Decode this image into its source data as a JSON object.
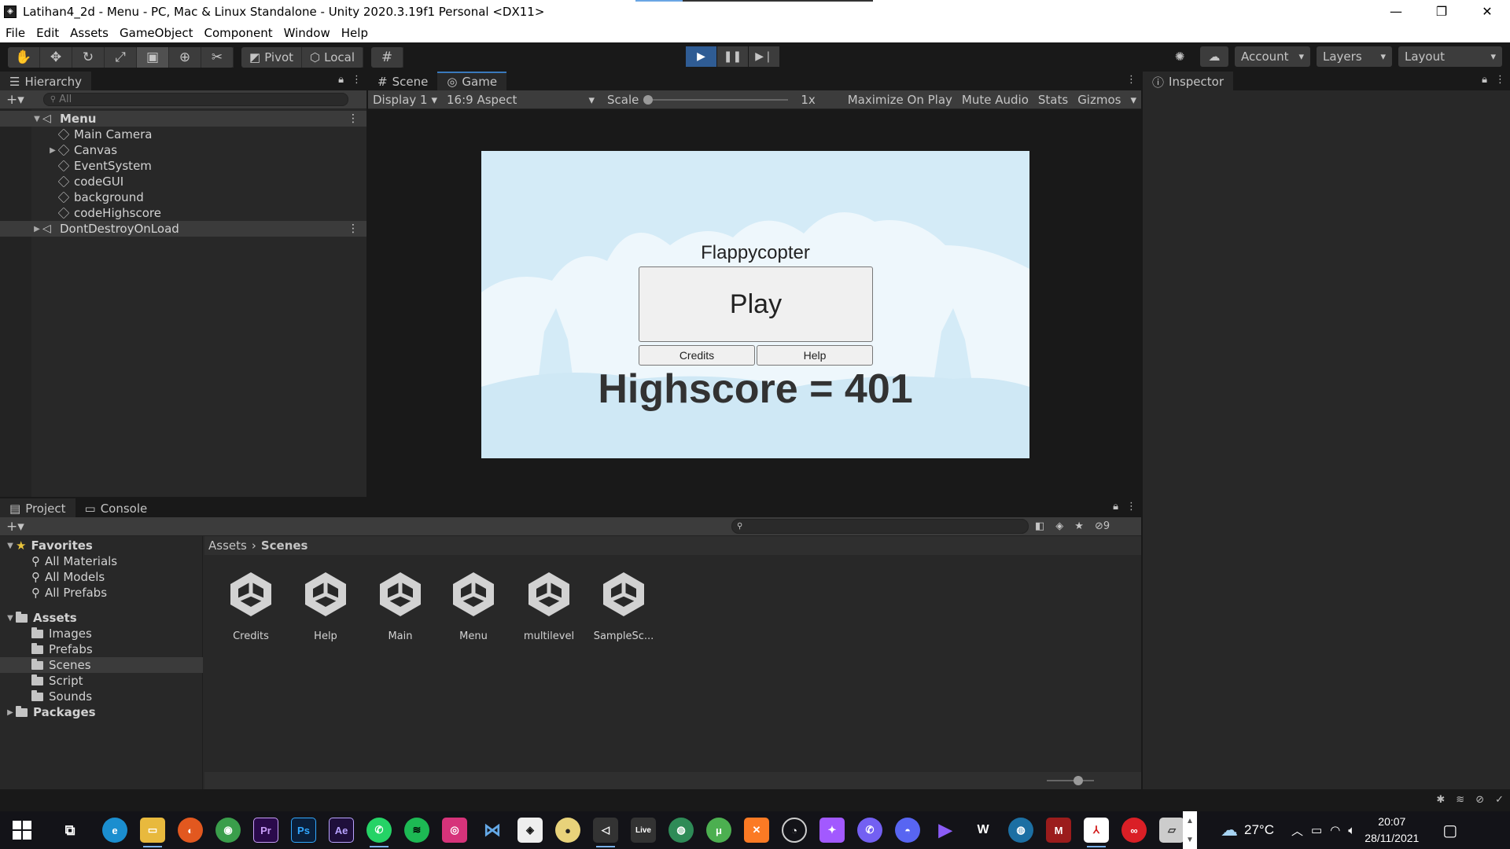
{
  "window": {
    "title": "Latihan4_2d - Menu - PC, Mac & Linux Standalone - Unity 2020.3.19f1 Personal <DX11>",
    "progress_fraction": 0.2
  },
  "menu": [
    "File",
    "Edit",
    "Assets",
    "GameObject",
    "Component",
    "Window",
    "Help"
  ],
  "toolbar": {
    "tools": [
      "hand-tool",
      "move-tool",
      "rotate-tool",
      "scale-tool",
      "rect-tool",
      "transform-tool",
      "custom-tool"
    ],
    "active_tool": "rect-tool",
    "pivot_label": "Pivot",
    "local_label": "Local",
    "playing": true,
    "account_label": "Account",
    "layers_label": "Layers",
    "layout_label": "Layout"
  },
  "hierarchy": {
    "tab_label": "Hierarchy",
    "search_placeholder": "All",
    "scene_name": "Menu",
    "items": [
      "Main Camera",
      "Canvas",
      "EventSystem",
      "codeGUI",
      "background",
      "codeHighscore"
    ],
    "dont_destroy": "DontDestroyOnLoad"
  },
  "game_view": {
    "tabs": [
      "Scene",
      "Game"
    ],
    "display_label": "Display 1",
    "aspect_label": "16:9 Aspect",
    "scale_label": "Scale",
    "scale_value": "1x",
    "buttons": [
      "Maximize On Play",
      "Mute Audio",
      "Stats",
      "Gizmos"
    ]
  },
  "game_ui": {
    "title": "Flappycopter",
    "play_label": "Play",
    "credits_label": "Credits",
    "help_label": "Help",
    "highscore_text": "Highscore = 401",
    "sky_color": "#d4ebf7",
    "cloud_color": "#eef7fc"
  },
  "inspector": {
    "tab_label": "Inspector"
  },
  "project": {
    "tabs": [
      "Project",
      "Console"
    ],
    "hidden_count": "9",
    "favorites_label": "Favorites",
    "favorites": [
      "All Materials",
      "All Models",
      "All Prefabs"
    ],
    "assets_label": "Assets",
    "asset_folders": [
      "Images",
      "Prefabs",
      "Scenes",
      "Script",
      "Sounds"
    ],
    "selected_folder": "Scenes",
    "packages_label": "Packages",
    "breadcrumb": [
      "Assets",
      "Scenes"
    ],
    "files": [
      "Credits",
      "Help",
      "Main",
      "Menu",
      "multilevel",
      "SampleSc..."
    ]
  },
  "taskbar": {
    "apps": [
      "Task View",
      "Edge",
      "File Explorer",
      "Firefox",
      "Chrome",
      "Premiere Pro",
      "Photoshop",
      "After Effects",
      "WhatsApp",
      "Spotify",
      "Instagram",
      "Visual Studio Code",
      "Unity Hub",
      "Media Player",
      "Unity",
      "Ableton Live",
      "Google Earth",
      "uTorrent",
      "XAMPP",
      "OBS Studio",
      "Figma",
      "Viber",
      "Discord",
      "Winamp",
      "Waves",
      "Globe",
      "Mendeley",
      "Acrobat Reader",
      "Creative Cloud",
      "Tablet"
    ],
    "temperature": "27°C",
    "time": "20:07",
    "date": "28/11/2021"
  },
  "colors": {
    "accent": "#3a79bb",
    "play_active": "#2f5c94",
    "editor_bg": "#282828"
  }
}
